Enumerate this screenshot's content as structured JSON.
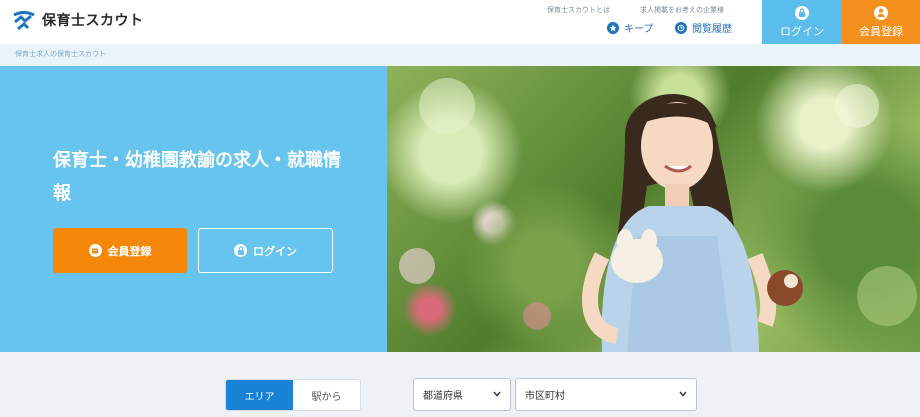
{
  "header": {
    "logo_text": "保育士スカウト",
    "top_links": {
      "about": "保育士スカウトとは",
      "ads": "求人掲載をお考えの企業様"
    },
    "nav": {
      "keep": "キープ",
      "history": "閲覧履歴"
    },
    "login_label": "ログイン",
    "register_label": "会員登録"
  },
  "breadcrumb": {
    "text": "保育士求人の保育士スカウト"
  },
  "hero": {
    "title": "保育士・幼稚園教諭の求人・就職情報",
    "register_button": "会員登録",
    "login_button": "ログイン"
  },
  "search": {
    "tabs": [
      {
        "label": "エリア",
        "active": true
      },
      {
        "label": "駅から",
        "active": false
      }
    ],
    "prefecture_select": "都道府県",
    "city_select": "市区町村"
  },
  "colors": {
    "accent_blue": "#1a82d4",
    "hero_blue": "#66c4ef",
    "orange": "#f5870b"
  }
}
